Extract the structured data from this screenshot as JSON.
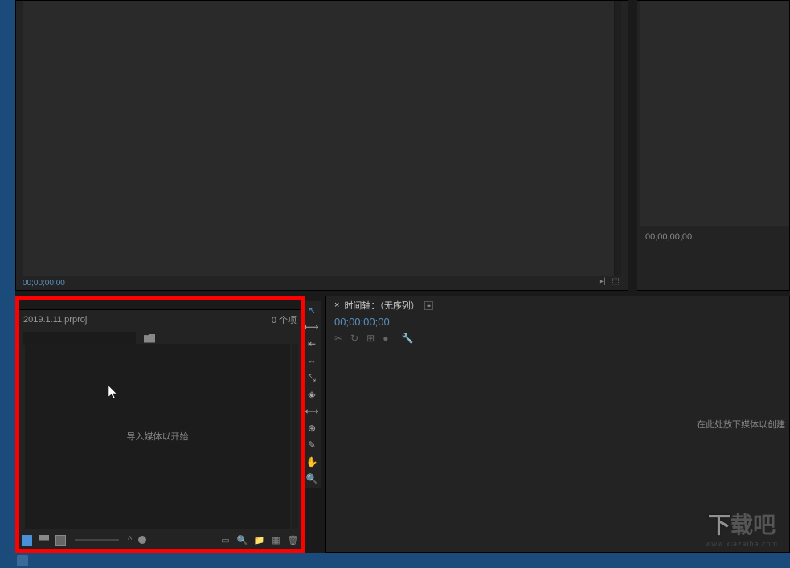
{
  "source": {
    "timecode": "00;00;00;00"
  },
  "program": {
    "timecode": "00;00;00;00"
  },
  "project": {
    "filename": "2019.1.11.prproj",
    "item_count": "0 个项",
    "import_prompt": "导入媒体以开始"
  },
  "timeline": {
    "tab_prefix": "×",
    "tab_label": "时间轴：（无序列）",
    "tab_menu": "≡",
    "timecode": "00;00;00;00",
    "drop_hint": "在此处放下媒体以创建"
  },
  "watermark": {
    "char1": "下",
    "char2": "载",
    "char3": "吧",
    "url": "www.xiazaiba.com"
  },
  "tools": {
    "selection": "↖",
    "track_select": "⟼",
    "ripple": "⇤",
    "rolling": "⇔",
    "rate": "⤡",
    "razor": "◈",
    "slip": "⟷",
    "slide": "⊕",
    "pen": "✎",
    "hand": "✋",
    "zoom": "🔍"
  },
  "timeline_tools": {
    "t1": "✂",
    "t2": "↻",
    "t3": "⊞",
    "t4": "●",
    "wrench": "🔧"
  }
}
